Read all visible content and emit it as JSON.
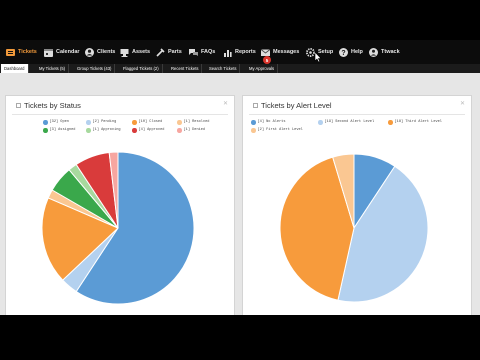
{
  "nav": {
    "items": [
      {
        "label": "Tickets",
        "icon": "tickets-icon",
        "active": true
      },
      {
        "label": "Calendar",
        "icon": "calendar-icon"
      },
      {
        "label": "Clients",
        "icon": "clients-icon"
      },
      {
        "label": "Assets",
        "icon": "assets-icon"
      },
      {
        "label": "Parts",
        "icon": "parts-icon"
      },
      {
        "label": "FAQs",
        "icon": "faqs-icon"
      },
      {
        "label": "Reports",
        "icon": "reports-icon"
      },
      {
        "label": "Messages",
        "icon": "messages-icon"
      },
      {
        "label": "Setup",
        "icon": "gear-icon"
      },
      {
        "label": "Help",
        "icon": "help-icon"
      },
      {
        "label": "Ttwack",
        "icon": "user-icon"
      }
    ],
    "messages_badge": "5",
    "accent_color": "#f29a3b"
  },
  "subtabs": [
    {
      "label": "Dashboard",
      "active": true
    },
    {
      "label": "My Tickets (5)"
    },
    {
      "label": "Group Tickets (43)"
    },
    {
      "label": "Flagged Tickets (2)"
    },
    {
      "label": "Recent Tickets"
    },
    {
      "label": "Search Tickets"
    },
    {
      "label": "My Approvals"
    }
  ],
  "panels": [
    {
      "title": "Tickets by Status",
      "legend": [
        {
          "label": "[32] Open",
          "color": "#5b9bd5"
        },
        {
          "label": "[2] Pending",
          "color": "#b4d1ef"
        },
        {
          "label": "[10] Closed",
          "color": "#f79b3c"
        },
        {
          "label": "[1] Resolved",
          "color": "#fac792"
        },
        {
          "label": "[3] Assigned",
          "color": "#3aa84b"
        },
        {
          "label": "[1] Approving",
          "color": "#a7d99e"
        },
        {
          "label": "[4] Approved",
          "color": "#d93b3b"
        },
        {
          "label": "[1] Denied",
          "color": "#f7a6a0"
        }
      ]
    },
    {
      "title": "Tickets by Alert Level",
      "legend": [
        {
          "label": "[4] No Alerts",
          "color": "#5b9bd5"
        },
        {
          "label": "[19] Second Alert Level",
          "color": "#b4d1ef"
        },
        {
          "label": "[18] Third Alert Level",
          "color": "#f79b3c"
        },
        {
          "label": "[2] First Alert Level",
          "color": "#fac792"
        }
      ]
    }
  ]
}
